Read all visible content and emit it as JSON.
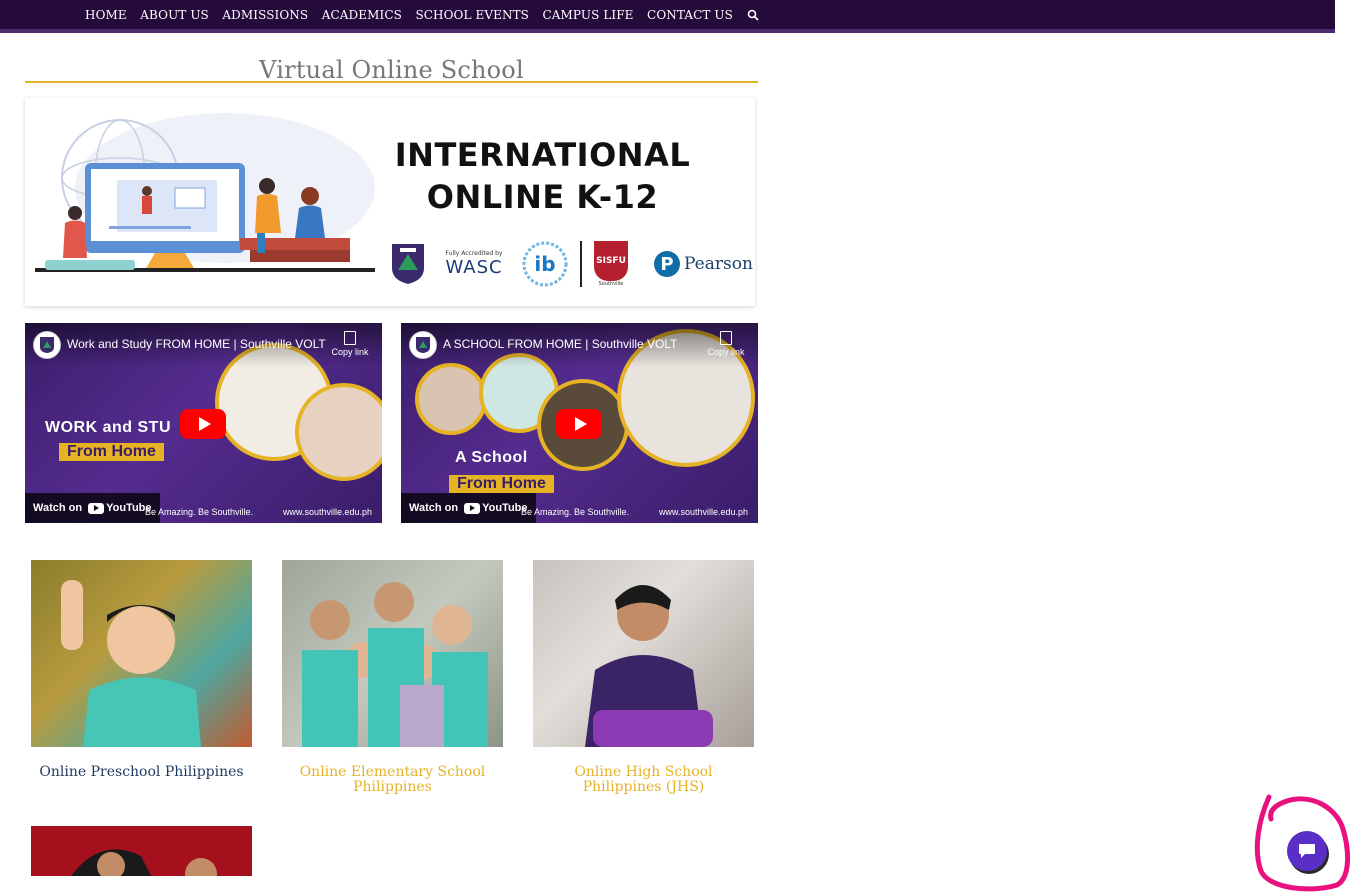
{
  "nav": {
    "items": [
      "HOME",
      "ABOUT US",
      "ADMISSIONS",
      "ACADEMICS",
      "SCHOOL EVENTS",
      "CAMPUS LIFE",
      "CONTACT US"
    ],
    "search_icon": "search-icon"
  },
  "page": {
    "title": "Virtual Online School"
  },
  "banner": {
    "line1": "INTERNATIONAL",
    "line2": "ONLINE K-12",
    "logos": {
      "wasc_small": "Fully Accredited by",
      "wasc": "WASC",
      "ib": "ib",
      "sisfu": "SISFU",
      "sisfu_sub": "Southville",
      "pearson": "Pearson"
    }
  },
  "videos": [
    {
      "title": "Work and Study FROM HOME | Southville VOLT",
      "copy_link": "Copy link",
      "headline1": "WORK and STU",
      "headline2": "From Home",
      "watch_on": "Watch on",
      "youtube": "YouTube",
      "tagline": "Be Amazing. Be Southville.",
      "url": "www.southville.edu.ph"
    },
    {
      "title": "A SCHOOL FROM HOME | Southville VOLT",
      "copy_link": "Copy link",
      "headline1": "A School",
      "headline2": "From Home",
      "watch_on": "Watch on",
      "youtube": "YouTube",
      "tagline": "Be Amazing. Be Southville.",
      "url": "www.southville.edu.ph"
    }
  ],
  "cards": [
    {
      "label": "Online Preschool Philippines",
      "color": "#1f3a5f"
    },
    {
      "label": "Online Elementary School Philippines",
      "color": "#e6b325"
    },
    {
      "label": "Online High School Philippines (JHS)",
      "color": "#e6b325"
    }
  ],
  "colors": {
    "nav_bg": "#250a3c",
    "accent_gold": "#e6b325",
    "chat_purple": "#5a2fc8",
    "annotation_pink": "#e8117f"
  }
}
